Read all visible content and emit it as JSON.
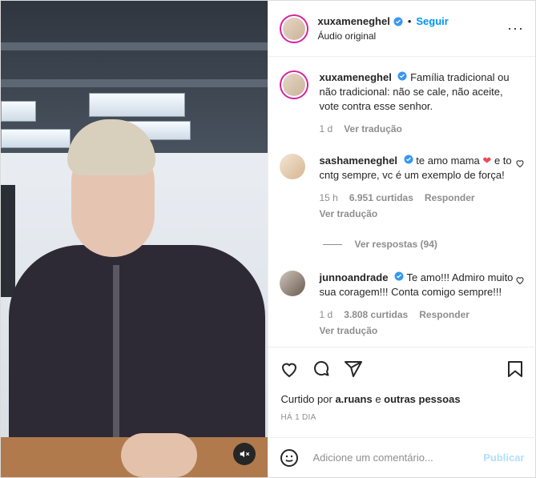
{
  "post": {
    "username": "xuxameneghel",
    "follow_label": "Seguir",
    "audio_label": "Áudio original",
    "dot": "•",
    "more_label": "···"
  },
  "caption": {
    "username": "xuxameneghel",
    "text": "Família tradicional ou não tradicional: não se cale, não aceite, vote contra esse senhor.",
    "time": "1 d",
    "translate": "Ver tradução"
  },
  "comments": [
    {
      "username": "sashameneghel",
      "text_pre": "te amo mama",
      "heart": "❤",
      "text_post": "e to cntg sempre, vc é um exemplo de força!",
      "time": "15 h",
      "likes": "6.951 curtidas",
      "reply": "Responder",
      "translate": "Ver tradução",
      "view_replies": "Ver respostas (94)"
    },
    {
      "username": "junnoandrade",
      "text": "Te amo!!! Admiro muito sua coragem!!! Conta comigo sempre!!!",
      "time": "1 d",
      "likes": "3.808 curtidas",
      "reply": "Responder",
      "translate": "Ver tradução"
    }
  ],
  "likes_summary": {
    "prefix": "Curtido por",
    "user": "a.ruans",
    "middle": "e",
    "others": "outras pessoas"
  },
  "date": "HÁ 1 DIA",
  "add_comment": {
    "placeholder": "Adicione um comentário...",
    "publish_label": "Publicar"
  },
  "colors": {
    "accent": "#0095f6",
    "verified": "#3897f0",
    "heart_red": "#ed4956",
    "muted": "#8e8e8e"
  },
  "icons": [
    "volume-off-icon",
    "verified-icon",
    "more-options-icon",
    "like-icon",
    "comment-icon",
    "share-icon",
    "save-icon",
    "emoji-icon"
  ]
}
